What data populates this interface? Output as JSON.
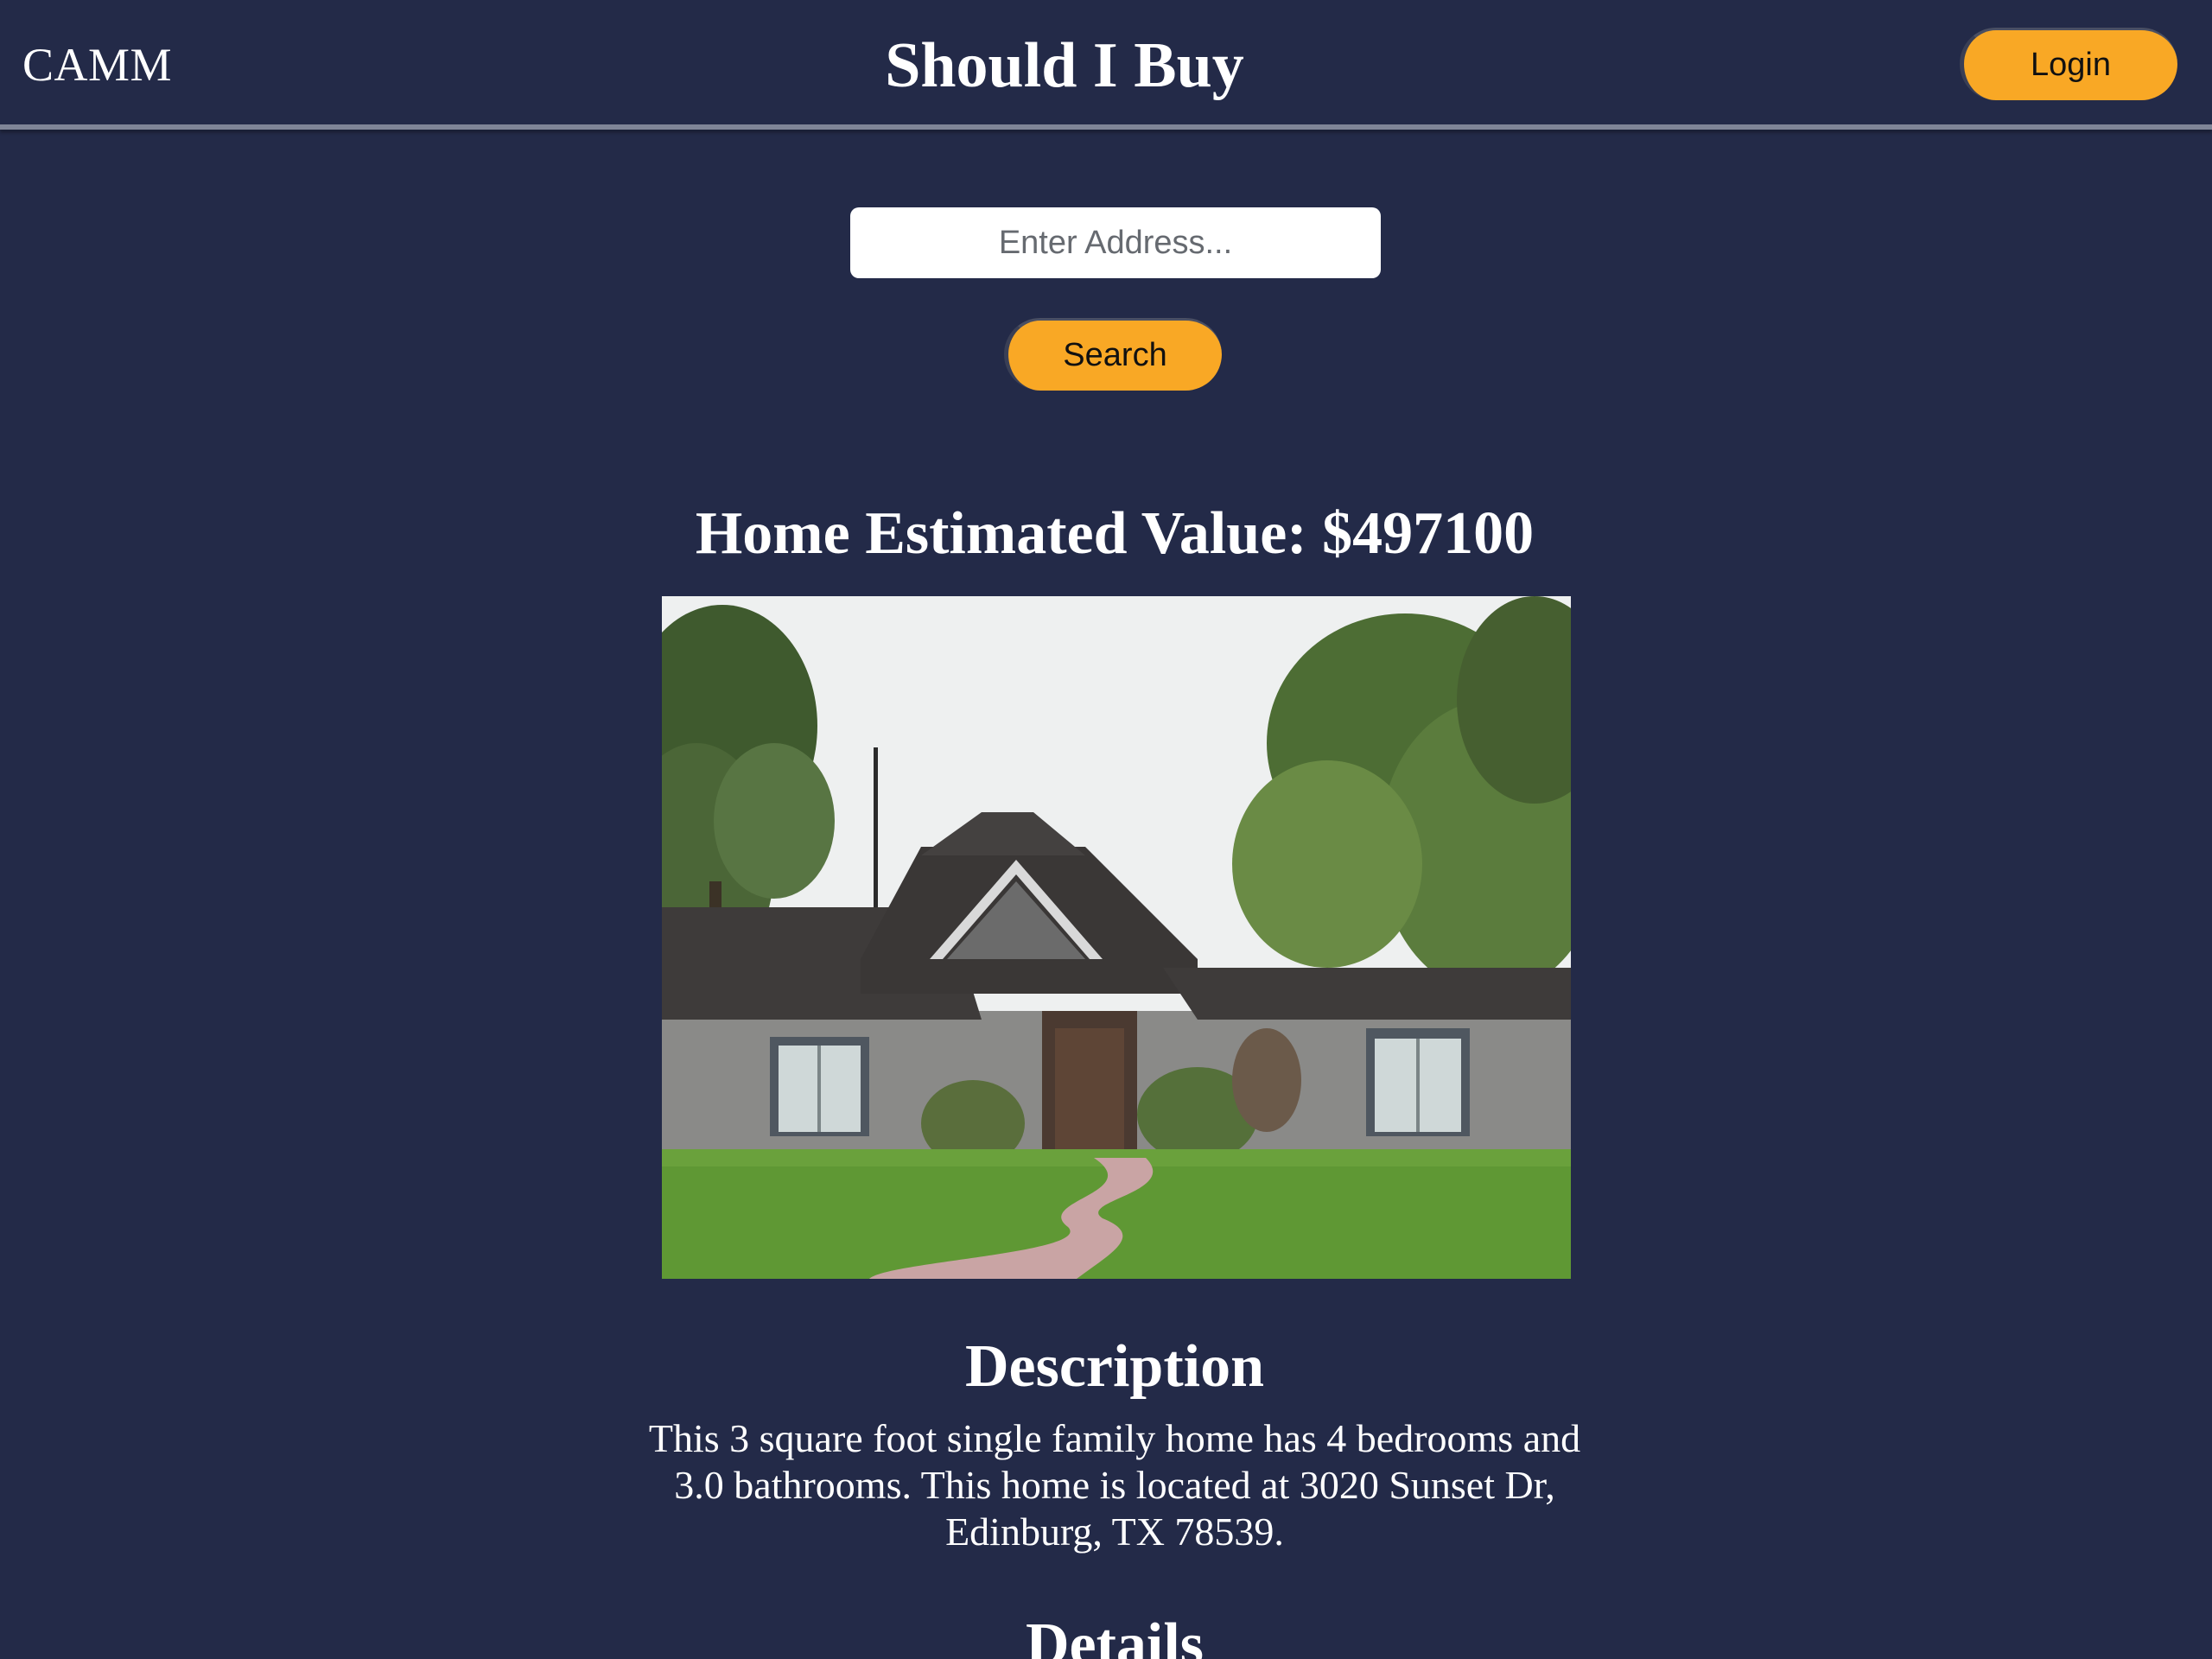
{
  "header": {
    "brand": "CAMM",
    "title": "Should I Buy",
    "login_label": "Login"
  },
  "search": {
    "placeholder": "Enter Address...",
    "value": "",
    "button_label": "Search"
  },
  "estimate": {
    "heading": "Home Estimated Value: $497100"
  },
  "photo": {
    "subject": "single-story-gray-brick-house-with-lawn"
  },
  "description": {
    "heading": "Description",
    "text": "This 3 square foot single family home has 4 bedrooms and 3.0 bathrooms. This home is located at 3020 Sunset Dr, Edinburg, TX 78539."
  },
  "details": {
    "heading": "Details"
  },
  "colors": {
    "background": "#232a48",
    "accent": "#f9a825",
    "text": "#ffffff"
  }
}
